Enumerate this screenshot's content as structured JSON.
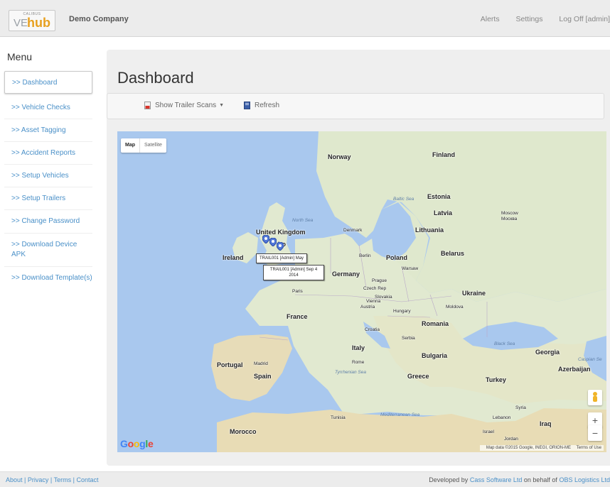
{
  "header": {
    "logo": {
      "brand_top": "CALIBUS",
      "brand_ve": "VE",
      "brand_hub": "hub"
    },
    "company": "Demo Company",
    "nav": [
      "Alerts",
      "Settings",
      "Log Off [admin]"
    ]
  },
  "sidebar": {
    "title": "Menu",
    "items": [
      {
        "label": ">> Dashboard",
        "active": true
      },
      {
        "label": ">> Vehicle Checks"
      },
      {
        "label": ">> Asset Tagging"
      },
      {
        "label": ">> Accident Reports"
      },
      {
        "label": ">> Setup Vehicles"
      },
      {
        "label": ">> Setup Trailers"
      },
      {
        "label": ">> Change Password"
      },
      {
        "label": ">> Download Device APK"
      },
      {
        "label": ">> Download Template(s)"
      }
    ]
  },
  "main": {
    "title": "Dashboard",
    "toolbar": {
      "show_scans": "Show Trailer Scans",
      "refresh": "Refresh"
    }
  },
  "map": {
    "type_map": "Map",
    "type_satellite": "Satellite",
    "countries": {
      "norway": "Norway",
      "finland": "Finland",
      "estonia": "Estonia",
      "latvia": "Latvia",
      "lithuania": "Lithuania",
      "denmark": "Denmark",
      "united_kingdom": "United Kingdom",
      "ireland": "Ireland",
      "poland": "Poland",
      "belarus": "Belarus",
      "germany": "Germany",
      "czech": "Czech Rep",
      "slovakia": "Slovakia",
      "austria": "Austria",
      "hungary": "Hungary",
      "ukraine": "Ukraine",
      "moldova": "Moldova",
      "france": "France",
      "romania": "Romania",
      "croatia": "Croatia",
      "serbia": "Serbia",
      "italy": "Italy",
      "bulgaria": "Bulgaria",
      "portugal": "Portugal",
      "spain": "Spain",
      "greece": "Greece",
      "turkey": "Turkey",
      "georgia": "Georgia",
      "azerbaijan": "Azerbaijan",
      "morocco": "Morocco",
      "tunisia": "Tunisia",
      "syria": "Syria",
      "lebanon": "Lebanon",
      "iraq": "Iraq",
      "israel": "Israel",
      "jordan": "Jordan"
    },
    "cities": {
      "moscow": "Moscow",
      "moscow_local": "Москва",
      "warsaw": "Warsaw",
      "berlin": "Berlin",
      "prague": "Prague",
      "vienna": "Vienna",
      "paris": "Paris",
      "madrid": "Madrid",
      "rome": "Rome",
      "london": "Lo",
      "dublin": "Dublin"
    },
    "seas": {
      "north": "North Sea",
      "baltic": "Baltic Sea",
      "black": "Black Sea",
      "caspian": "Caspian Se",
      "tyrrhenian": "Tyrrhenian Sea",
      "mediterranean": "Mediterranean Sea"
    },
    "callouts": [
      "TRAIL001 [Admin] May",
      "TRAIL001 [Admin] Sep 4 2014"
    ],
    "attribution": "Map data ©2015 Google, INEGI, ORION-ME",
    "terms": "Terms of Use",
    "zoom_in": "+",
    "zoom_out": "−"
  },
  "footer": {
    "links": [
      "About",
      "Privacy",
      "Terms",
      "Contact"
    ],
    "developed_by": "Developed by",
    "dev_company": "Cass Software Ltd",
    "on_behalf": "on behalf of",
    "client": "OBS Logistics Ltd"
  }
}
